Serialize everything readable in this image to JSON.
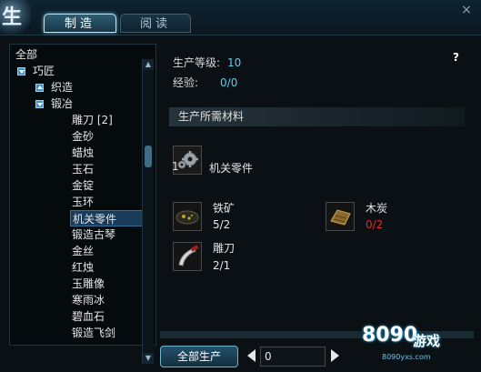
{
  "header": {
    "emblem_text": "生",
    "tabs": [
      {
        "label": "制造",
        "active": true
      },
      {
        "label": "阅读",
        "active": false
      }
    ],
    "close_glyph": "×"
  },
  "tree": {
    "items": [
      {
        "label": "全部",
        "level": 0,
        "expander": "none"
      },
      {
        "label": "巧匠",
        "level": 1,
        "expander": "down"
      },
      {
        "label": "织造",
        "level": 2,
        "expander": "up"
      },
      {
        "label": "锻冶",
        "level": 2,
        "expander": "down"
      },
      {
        "label": "雕刀 [2]",
        "level": 3,
        "expander": "none"
      },
      {
        "label": "金砂",
        "level": 3,
        "expander": "none"
      },
      {
        "label": "蜡烛",
        "level": 3,
        "expander": "none"
      },
      {
        "label": "玉石",
        "level": 3,
        "expander": "none"
      },
      {
        "label": "金锭",
        "level": 3,
        "expander": "none"
      },
      {
        "label": "玉环",
        "level": 3,
        "expander": "none"
      },
      {
        "label": "机关零件",
        "level": 3,
        "expander": "none",
        "selected": true
      },
      {
        "label": "锻造古琴",
        "level": 3,
        "expander": "none"
      },
      {
        "label": "金丝",
        "level": 3,
        "expander": "none"
      },
      {
        "label": "红烛",
        "level": 3,
        "expander": "none"
      },
      {
        "label": "玉雕像",
        "level": 3,
        "expander": "none"
      },
      {
        "label": "寒雨冰",
        "level": 3,
        "expander": "none"
      },
      {
        "label": "碧血石",
        "level": 3,
        "expander": "none"
      },
      {
        "label": "锻造飞剑",
        "level": 3,
        "expander": "none"
      }
    ]
  },
  "detail": {
    "level_label": "生产等级:",
    "level_value": "10",
    "exp_label": "经验:",
    "exp_value": "0/0",
    "help_glyph": "?",
    "materials_header": "生产所需材料",
    "product": {
      "name": "机关零件",
      "count": "1",
      "icon": "gear-icon"
    },
    "materials": [
      {
        "name": "铁矿",
        "count": "5/2",
        "sufficient": true,
        "icon": "iron-ore-icon"
      },
      {
        "name": "木炭",
        "count": "0/2",
        "sufficient": false,
        "icon": "charcoal-icon"
      },
      {
        "name": "雕刀",
        "count": "2/1",
        "sufficient": true,
        "icon": "carving-knife-icon"
      }
    ]
  },
  "footer": {
    "craft_all_label": "全部生产",
    "quantity_value": "0"
  },
  "watermark": {
    "logo": "8090",
    "sub": "游戏",
    "url": "8090yxs.com"
  },
  "colors": {
    "accent": "#5fcdea",
    "insufficient": "#e02626",
    "selected_bg": "#183c5a"
  }
}
